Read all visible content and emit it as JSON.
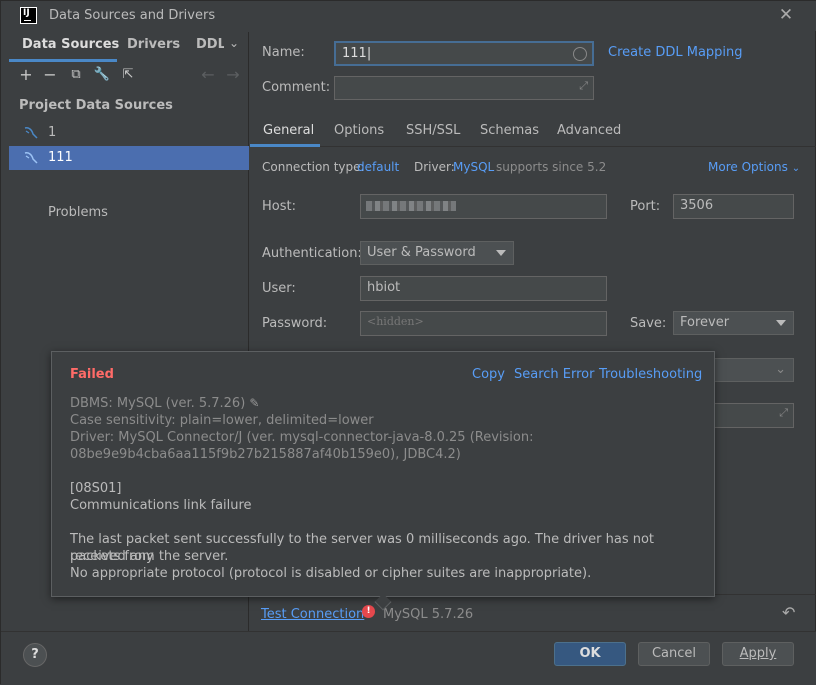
{
  "window": {
    "title": "Data Sources and Drivers"
  },
  "left": {
    "tabs": [
      "Data Sources",
      "Drivers",
      "DDL"
    ],
    "section_title": "Project Data Sources",
    "items": [
      {
        "label": "1",
        "selected": false
      },
      {
        "label": "111",
        "selected": true
      }
    ],
    "problems": "Problems"
  },
  "form": {
    "name_label": "Name:",
    "name_value": "111",
    "ddl_link": "Create DDL Mapping",
    "comment_label": "Comment:",
    "tabs": [
      "General",
      "Options",
      "SSH/SSL",
      "Schemas",
      "Advanced"
    ],
    "conn_type_label": "Connection type:",
    "conn_type_value": "default",
    "driver_label": "Driver:",
    "driver_value": "MySQL",
    "driver_note": "supports since 5.2",
    "more_options": "More Options",
    "host_label": "Host:",
    "port_label": "Port:",
    "port_value": "3506",
    "auth_label": "Authentication:",
    "auth_value": "User & Password",
    "user_label": "User:",
    "user_value": "hbiot",
    "password_label": "Password:",
    "password_value": "<hidden>",
    "save_label": "Save:",
    "save_value": "Forever"
  },
  "popup": {
    "status": "Failed",
    "actions": [
      "Copy",
      "Search Error",
      "Troubleshooting"
    ],
    "dbms": "DBMS: MySQL (ver. 5.7.26)",
    "case": "Case sensitivity: plain=lower, delimited=lower",
    "driver1": "Driver: MySQL Connector/J (ver. mysql-connector-java-8.0.25 (Revision:",
    "driver2": "08be9e9b4cba6aa115f9b27b215887af40b159e0), JDBC4.2)",
    "code": "[08S01]",
    "error": "Communications link failure",
    "msg1": "The last packet sent successfully to the server was 0 milliseconds ago. The driver has not received any",
    "msg2": "packets from the server.",
    "msg3": "No appropriate protocol (protocol is disabled or cipher suites are inappropriate)."
  },
  "status": {
    "test_link": "Test Connection",
    "db_version": "MySQL 5.7.26"
  },
  "footer": {
    "help": "?",
    "ok": "OK",
    "cancel": "Cancel",
    "apply": "Apply"
  },
  "colors": {
    "accent": "#4b6eaf",
    "link": "#589df6",
    "error": "#ff6b68"
  }
}
